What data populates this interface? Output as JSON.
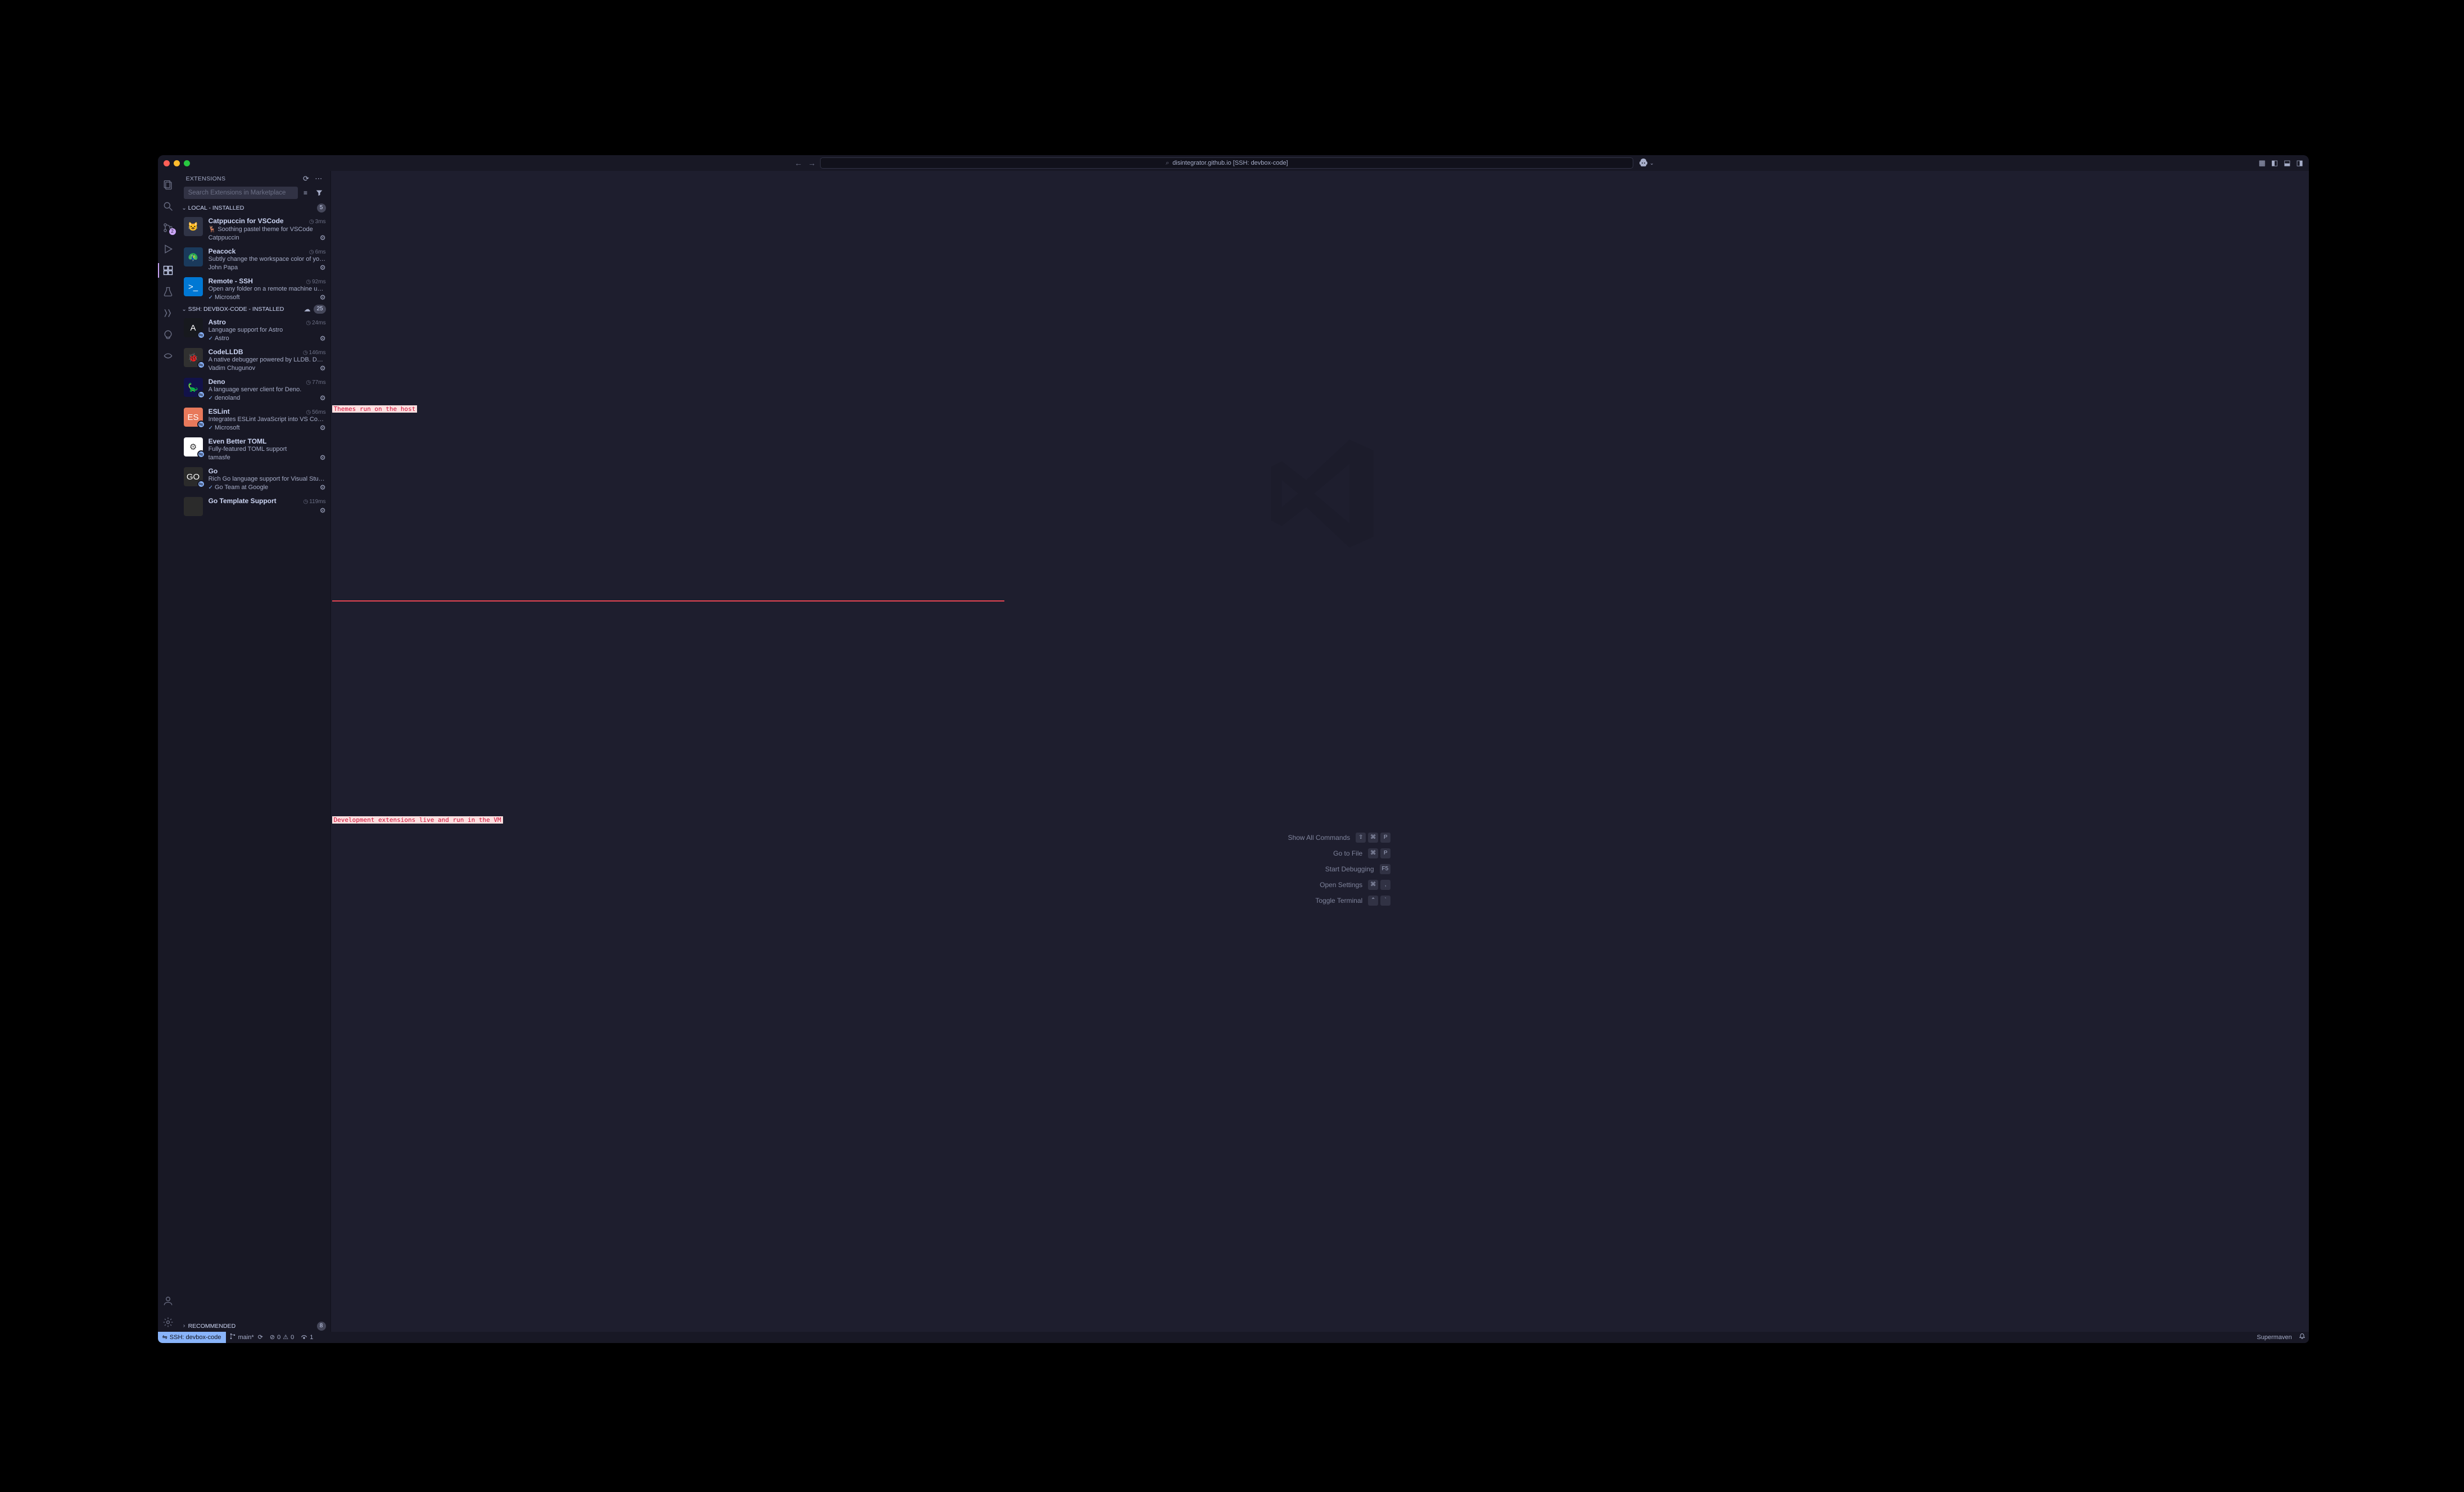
{
  "titlebar": {
    "repo": "disintegrator.github.io [SSH: devbox-code]"
  },
  "activity": {
    "scm_badge": "2"
  },
  "sidebar": {
    "title": "Extensions",
    "search_placeholder": "Search Extensions in Marketplace",
    "sections": {
      "local": {
        "label": "Local - Installed",
        "count": "5"
      },
      "remote": {
        "label": "SSH: devbox-code - Installed",
        "count": "25"
      },
      "recommended": {
        "label": "Recommended",
        "count": "8"
      }
    },
    "local_items": [
      {
        "name": "Catppuccin for VSCode",
        "desc": "🦌 Soothing pastel theme for VSCode",
        "publisher": "Catppuccin",
        "time": "3ms",
        "verified": false,
        "color": "#303446",
        "letter": "😺",
        "remote_badge": false
      },
      {
        "name": "Peacock",
        "desc": "Subtly change the workspace color of your…",
        "publisher": "John Papa",
        "time": "6ms",
        "verified": false,
        "color": "#1a3a5c",
        "letter": "🦚",
        "remote_badge": false
      },
      {
        "name": "Remote - SSH",
        "desc": "Open any folder on a remote machine usin…",
        "publisher": "Microsoft",
        "time": "92ms",
        "verified": true,
        "color": "#0078d4",
        "letter": ">_",
        "remote_badge": false
      }
    ],
    "remote_items": [
      {
        "name": "Astro",
        "desc": "Language support for Astro",
        "publisher": "Astro",
        "time": "24ms",
        "verified": true,
        "color": "#17191e",
        "letter": "A",
        "remote_badge": true
      },
      {
        "name": "CodeLLDB",
        "desc": "A native debugger powered by LLDB. Deb…",
        "publisher": "Vadim Chugunov",
        "time": "146ms",
        "verified": false,
        "color": "#303030",
        "letter": "🐞",
        "remote_badge": true
      },
      {
        "name": "Deno",
        "desc": "A language server client for Deno.",
        "publisher": "denoland",
        "time": "77ms",
        "verified": true,
        "color": "#12124a",
        "letter": "🦕",
        "remote_badge": true
      },
      {
        "name": "ESLint",
        "desc": "Integrates ESLint JavaScript into VS Code.",
        "publisher": "Microsoft",
        "time": "56ms",
        "verified": true,
        "color": "#e8795b",
        "letter": "ES",
        "remote_badge": true
      },
      {
        "name": "Even Better TOML",
        "desc": "Fully-featured TOML support",
        "publisher": "tamasfe",
        "time": "",
        "verified": false,
        "color": "#ffffff",
        "letter": "⚙",
        "remote_badge": true
      },
      {
        "name": "Go",
        "desc": "Rich Go language support for Visual Studi…",
        "publisher": "Go Team at Google",
        "time": "",
        "verified": true,
        "color": "#2b2b2b",
        "letter": "GO",
        "remote_badge": true
      },
      {
        "name": "Go Template Support",
        "desc": "",
        "publisher": "",
        "time": "119ms",
        "verified": false,
        "color": "#2b2b2b",
        "letter": "",
        "remote_badge": false
      }
    ]
  },
  "annotations": {
    "top": "Themes run on the host",
    "bottom": "Development extensions live and run in the VM"
  },
  "welcome": [
    {
      "label": "Show All Commands",
      "keys": [
        "⇧",
        "⌘",
        "P"
      ]
    },
    {
      "label": "Go to File",
      "keys": [
        "⌘",
        "P"
      ]
    },
    {
      "label": "Start Debugging",
      "keys": [
        "F5"
      ]
    },
    {
      "label": "Open Settings",
      "keys": [
        "⌘",
        ","
      ]
    },
    {
      "label": "Toggle Terminal",
      "keys": [
        "⌃",
        "`"
      ]
    }
  ],
  "statusbar": {
    "remote": "SSH: devbox-code",
    "branch": "main*",
    "errors": "0",
    "warnings": "0",
    "ports": "1",
    "right1": "Supermaven"
  }
}
